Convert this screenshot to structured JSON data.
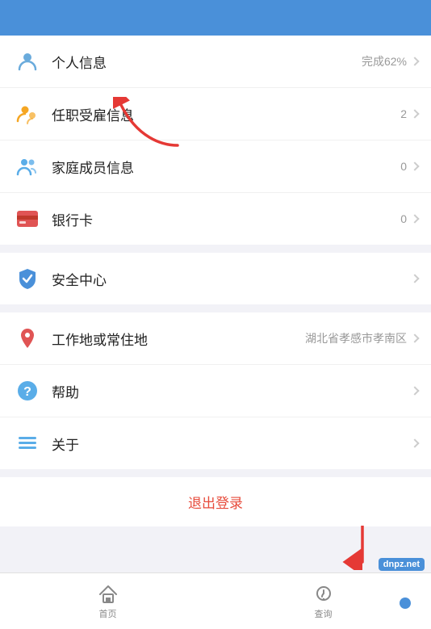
{
  "topBar": {
    "color": "#4a90d9"
  },
  "sections": [
    {
      "items": [
        {
          "id": "personal-info",
          "label": "个人信息",
          "value": "完成62%",
          "iconType": "person"
        },
        {
          "id": "employment-info",
          "label": "任职受雇信息",
          "value": "2",
          "iconType": "employ"
        },
        {
          "id": "family-info",
          "label": "家庭成员信息",
          "value": "0",
          "iconType": "family"
        },
        {
          "id": "bank-card",
          "label": "银行卡",
          "value": "0",
          "iconType": "bank"
        }
      ]
    },
    {
      "items": [
        {
          "id": "security-center",
          "label": "安全中心",
          "value": "",
          "iconType": "security"
        }
      ]
    },
    {
      "items": [
        {
          "id": "work-location",
          "label": "工作地或常住地",
          "value": "湖北省孝感市孝南区",
          "iconType": "location"
        },
        {
          "id": "help",
          "label": "帮助",
          "value": "",
          "iconType": "help"
        },
        {
          "id": "about",
          "label": "关于",
          "value": "",
          "iconType": "about"
        }
      ]
    }
  ],
  "logout": {
    "label": "退出登录"
  },
  "bottomNav": {
    "items": [
      {
        "id": "home",
        "label": "首页",
        "active": false
      },
      {
        "id": "query",
        "label": "查询",
        "active": false
      }
    ]
  }
}
